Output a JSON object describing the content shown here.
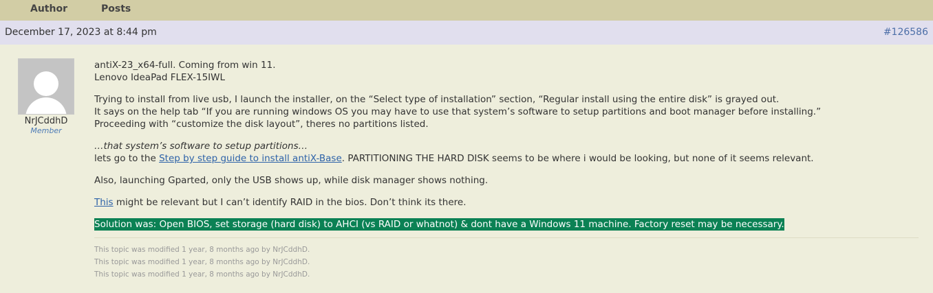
{
  "header": {
    "author_label": "Author",
    "posts_label": "Posts"
  },
  "post": {
    "date": "December 17, 2023 at 8:44 pm",
    "id_link": "#126586",
    "author": {
      "name": "NrJCddhD",
      "role": "Member"
    },
    "paragraph1": {
      "line1": "antiX-23_x64-full. Coming from win 11.",
      "line2": "Lenovo IdeaPad FLEX-15IWL"
    },
    "paragraph2": {
      "line1": "Trying to install from live usb, I launch the installer, on the “Select type of installation” section, “Regular install using the entire disk” is grayed out.",
      "line2": "It says on the help tab “If you are running windows OS you may have to use that system’s software to setup partitions and boot manager before installing.”",
      "line3": "Proceeding with “customize the disk layout”, theres no partitions listed."
    },
    "paragraph3": {
      "quote": "…that system’s software to setup partitions…",
      "pre_link": "lets go to the ",
      "link": "Step by step guide to install antiX-Base",
      "post_link": ". PARTITIONING THE HARD DISK seems to be where i would be looking, but none of it seems relevant."
    },
    "paragraph4": "Also, launching Gparted, only the USB shows up, while disk manager shows nothing.",
    "paragraph5": {
      "link": "This",
      "rest": " might be relevant but I can’t identify RAID in the bios. Don’t think its there."
    },
    "solution": "Solution was: Open BIOS, set storage (hard disk) to AHCI (vs RAID or whatnot) & dont have a Windows 11 machine. Factory reset may be necessary.",
    "revisions": [
      "This topic was modified 1 year, 8 months ago by NrJCddhD.",
      "This topic was modified 1 year, 8 months ago by NrJCddhD.",
      "This topic was modified 1 year, 8 months ago by NrJCddhD."
    ]
  },
  "colors": {
    "header_bg": "#d2cda5",
    "meta_bg": "#e1dfee",
    "body_bg": "#eeeedc",
    "link": "#2d62a8",
    "highlight_bg": "#0b8154"
  },
  "icons": {
    "avatar": "default-user-avatar-icon"
  }
}
